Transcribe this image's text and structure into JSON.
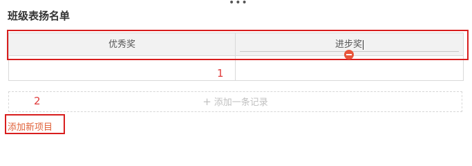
{
  "toolbar": {
    "more_glyph": "•••"
  },
  "section": {
    "title": "班级表扬名单"
  },
  "table": {
    "columns": [
      "优秀奖",
      "进步奖"
    ],
    "rows": [
      [
        "",
        ""
      ]
    ]
  },
  "annotations": {
    "label_1": "1",
    "label_2": "2"
  },
  "actions": {
    "add_record_plus": "+",
    "add_record_label": "添加一条记录",
    "add_item_label": "添加新项目"
  },
  "colors": {
    "highlight": "#d81e1e",
    "link": "#e0623a",
    "remove_icon": "#e8553a"
  },
  "icons": {
    "remove": "minus-circle-icon",
    "more": "ellipsis-icon"
  }
}
